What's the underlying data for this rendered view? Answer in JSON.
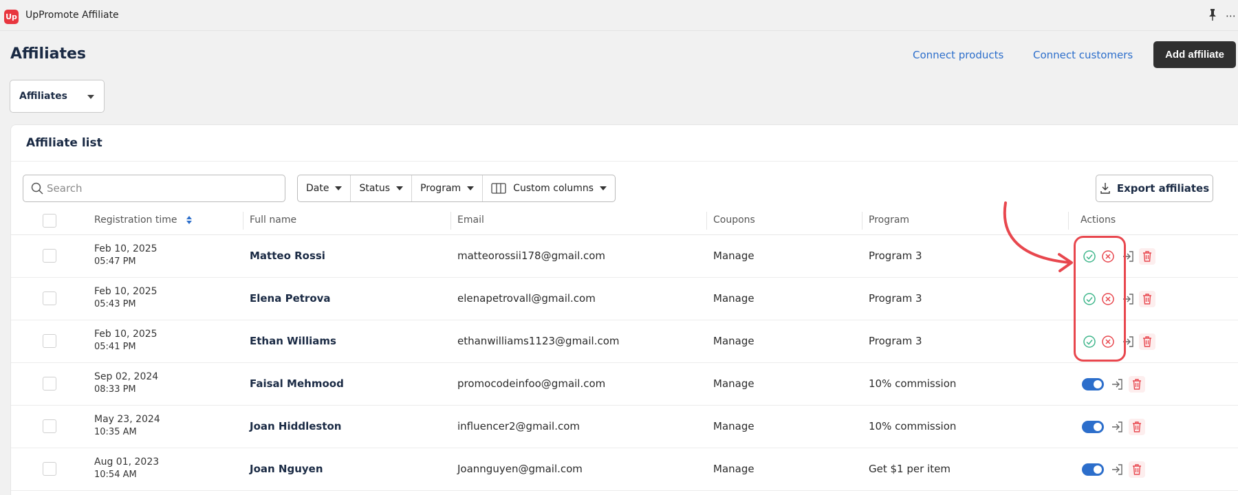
{
  "app": {
    "title": "UpPromote Affiliate",
    "logo_text": "Up"
  },
  "header": {
    "title": "Affiliates",
    "links": {
      "connect_products": "Connect products",
      "connect_customers": "Connect customers"
    },
    "add_button": "Add affiliate"
  },
  "view_select": {
    "value": "Affiliates"
  },
  "card": {
    "title": "Affiliate list",
    "search_placeholder": "Search",
    "filters": {
      "date": "Date",
      "status": "Status",
      "program": "Program",
      "custom_columns": "Custom columns"
    },
    "export_button": "Export affiliates"
  },
  "table": {
    "columns": {
      "registration": "Registration time",
      "full_name": "Full name",
      "email": "Email",
      "coupons": "Coupons",
      "program": "Program",
      "actions": "Actions"
    },
    "rows": [
      {
        "date": "Feb 10, 2025",
        "time": "05:47 PM",
        "name": "Matteo Rossi",
        "email": "matteorossii178@gmail.com",
        "coupons": "Manage",
        "program": "Program 3",
        "status": "pending"
      },
      {
        "date": "Feb 10, 2025",
        "time": "05:43 PM",
        "name": "Elena Petrova",
        "email": "elenapetrovall@gmail.com",
        "coupons": "Manage",
        "program": "Program 3",
        "status": "pending"
      },
      {
        "date": "Feb 10, 2025",
        "time": "05:41 PM",
        "name": "Ethan Williams",
        "email": "ethanwilliams1123@gmail.com",
        "coupons": "Manage",
        "program": "Program 3",
        "status": "pending"
      },
      {
        "date": "Sep 02, 2024",
        "time": "08:33 PM",
        "name": "Faisal Mehmood",
        "email": "promocodeinfoo@gmail.com",
        "coupons": "Manage",
        "program": "10% commission",
        "status": "active"
      },
      {
        "date": "May 23, 2024",
        "time": "10:35 AM",
        "name": "Joan Hiddleston",
        "email": "influencer2@gmail.com",
        "coupons": "Manage",
        "program": "10% commission",
        "status": "active"
      },
      {
        "date": "Aug 01, 2023",
        "time": "10:54 AM",
        "name": "Joan Nguyen",
        "email": "Joannguyen@gmail.com",
        "coupons": "Manage",
        "program": "Get $1 per item",
        "status": "active"
      }
    ]
  },
  "colors": {
    "accent": "#2c6ecb",
    "brand": "#e8363f",
    "approve": "#3fb68b",
    "reject": "#e8474e",
    "annotation": "#e8474e",
    "dark_button": "#303030"
  },
  "icons": [
    "search-icon",
    "caret-down-icon",
    "columns-icon",
    "export-icon",
    "sort-icon",
    "approve-icon",
    "reject-icon",
    "login-as-icon",
    "trash-icon",
    "pin-icon",
    "more-icon"
  ]
}
